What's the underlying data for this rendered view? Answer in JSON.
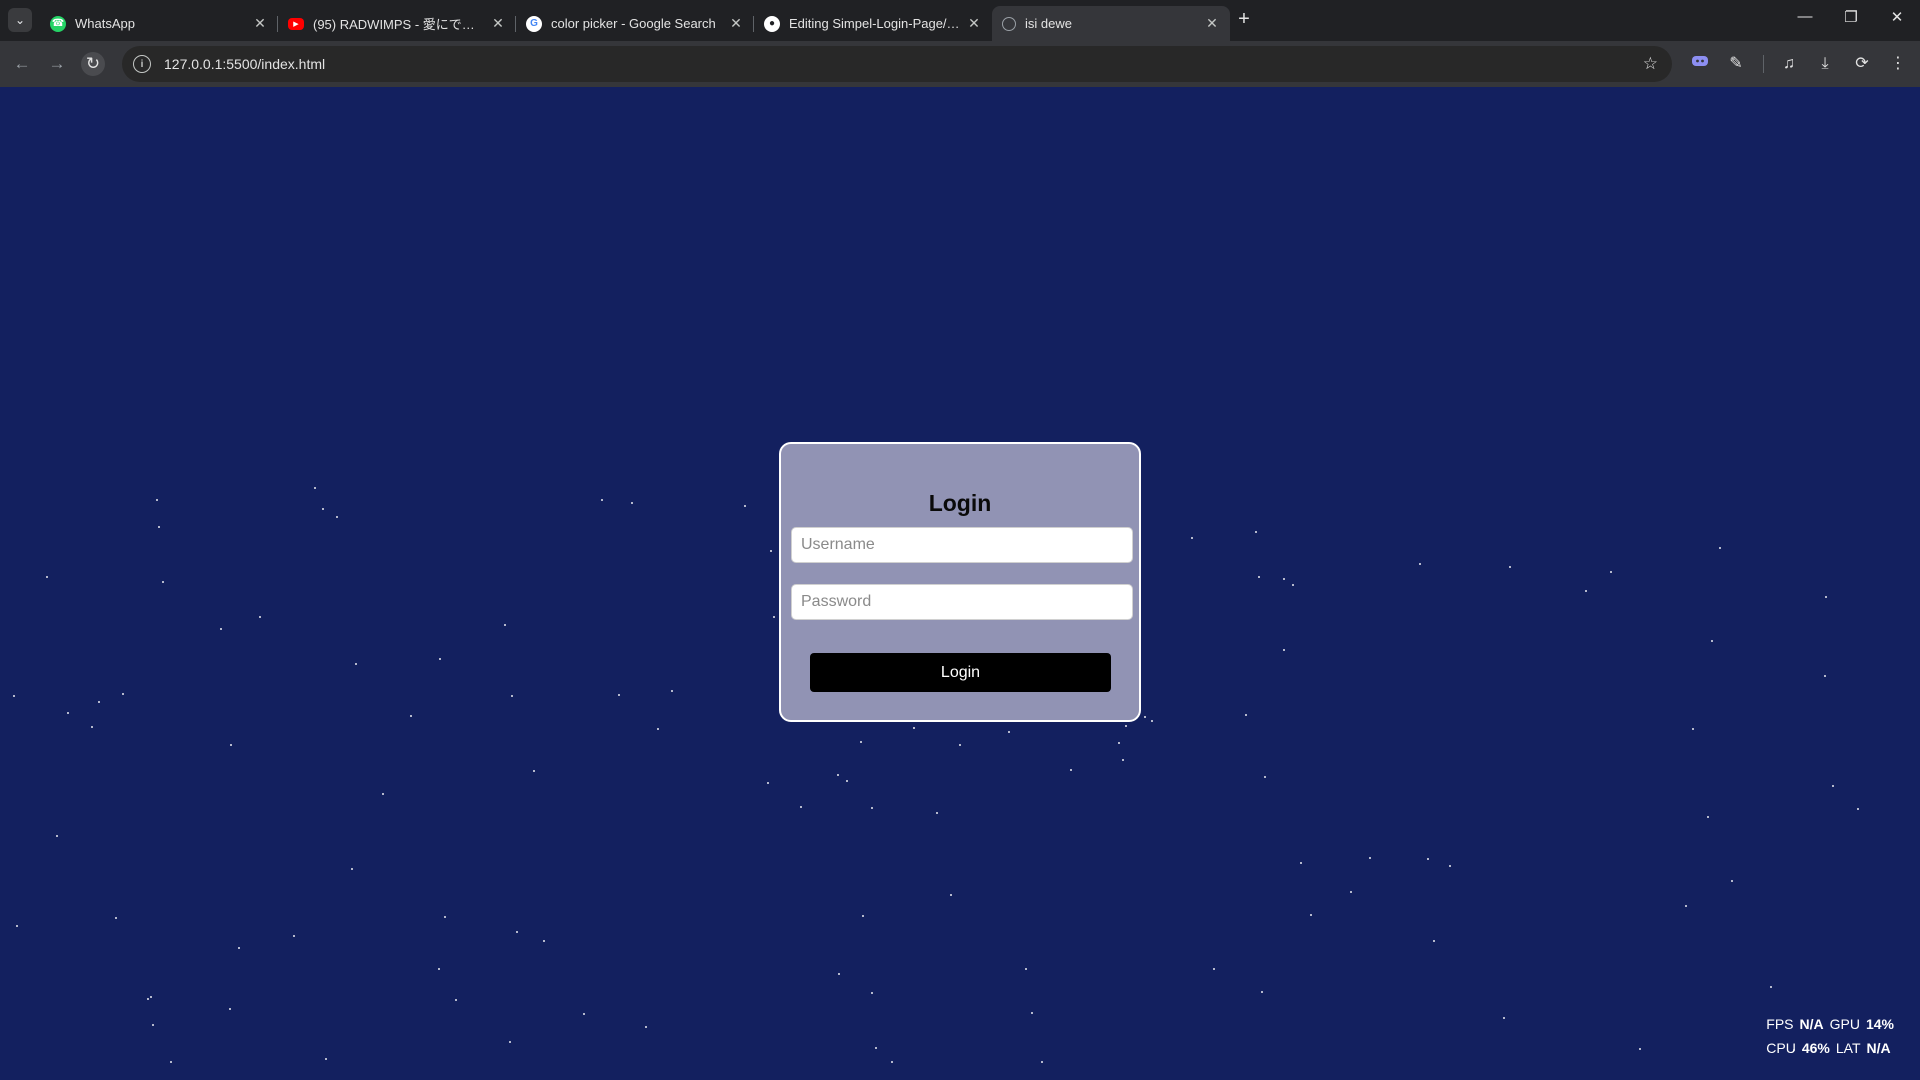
{
  "browser": {
    "tabs": [
      {
        "title": "WhatsApp",
        "favicon": "whatsapp-icon",
        "color": "#25d366",
        "active": false
      },
      {
        "title": "(95) RADWIMPS - 愛にできることはまだあるかい",
        "favicon": "youtube-icon",
        "color": "#ff0000",
        "active": false
      },
      {
        "title": "color picker - Google Search",
        "favicon": "google-icon",
        "color": "#ffffff",
        "active": false
      },
      {
        "title": "Editing Simpel-Login-Page/README.md",
        "favicon": "github-icon",
        "color": "#ffffff",
        "active": false
      },
      {
        "title": "isi dewe",
        "favicon": "globe-icon",
        "color": "#9aa0a6",
        "active": true
      }
    ],
    "url": "127.0.0.1:5500/index.html"
  },
  "login": {
    "title": "Login",
    "username_placeholder": "Username",
    "password_placeholder": "Password",
    "button_label": "Login"
  },
  "perf": {
    "fps_label": "FPS",
    "fps_value": "N/A",
    "gpu_label": "GPU",
    "gpu_value": "14%",
    "cpu_label": "CPU",
    "cpu_value": "46%",
    "lat_label": "LAT",
    "lat_value": "N/A"
  },
  "colors": {
    "page_background": "#13205f",
    "card_background": "#9193b4",
    "button_background": "#000000"
  }
}
